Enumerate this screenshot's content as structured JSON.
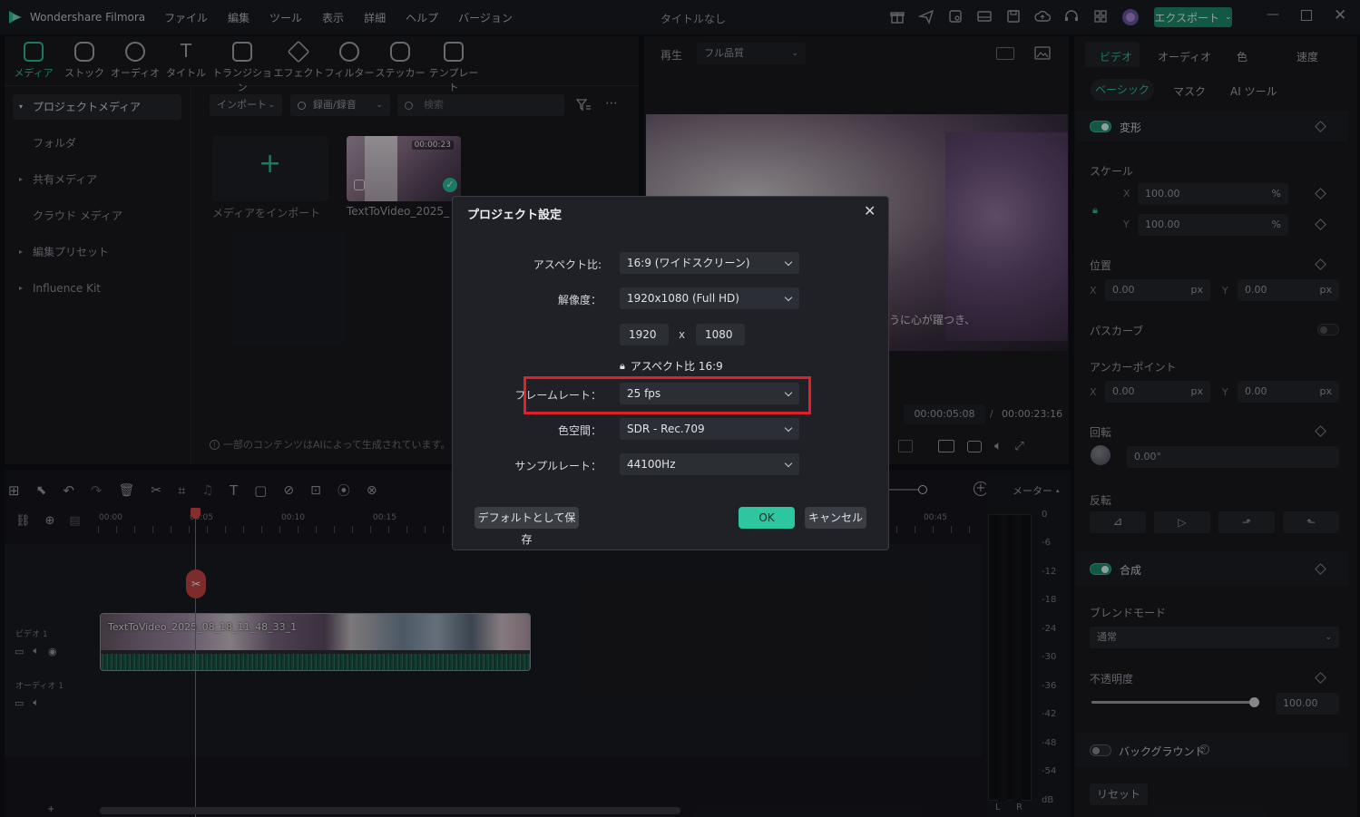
{
  "app": {
    "name": "Wondershare Filmora",
    "menu": [
      "ファイル",
      "編集",
      "ツール",
      "表示",
      "詳細",
      "ヘルプ",
      "バージョン"
    ],
    "project_title": "タイトルなし",
    "export_label": "エクスポート"
  },
  "toolbar": {
    "tabs": [
      "メディア",
      "ストック",
      "オーディオ",
      "タイトル",
      "トランジション",
      "エフェクト",
      "フィルター",
      "ステッカー",
      "テンプレート"
    ]
  },
  "sidebar": {
    "items": [
      "プロジェクトメディア",
      "フォルダ",
      "共有メディア",
      "クラウド メディア",
      "編集プリセット",
      "Influence Kit"
    ]
  },
  "media": {
    "import_label": "インポート",
    "record_label": "録画/録音",
    "search_placeholder": "検索",
    "import_tile_label": "メディアをインポート",
    "clip_name": "TextToVideo_2025_",
    "clip_duration": "00:00:23",
    "ai_notice": "一部のコンテンツはAIによって生成されています。これが"
  },
  "player": {
    "play_label": "再生",
    "quality": "フル品質",
    "current_time": "00:00:05:08",
    "separator": "/",
    "total_time": "00:00:23:16",
    "subtitle_fragment": "うに心が躍つき、"
  },
  "right_panel": {
    "tabs": [
      "ビデオ",
      "オーディオ",
      "色",
      "速度"
    ],
    "subtabs": [
      "ベーシック",
      "マスク",
      "AI ツール"
    ],
    "transform": "変形",
    "scale": "スケール",
    "scale_x": "100.00",
    "scale_y": "100.00",
    "percent": "%",
    "position": "位置",
    "pos_x": "0.00",
    "pos_y": "0.00",
    "px": "px",
    "path_curve": "パスカーブ",
    "anchor": "アンカーポイント",
    "anchor_x": "0.00",
    "anchor_y": "0.00",
    "rotation": "回転",
    "rotation_value": "0.00°",
    "flip": "反転",
    "composite": "合成",
    "blend_mode": "ブレンドモード",
    "blend_value": "通常",
    "opacity": "不透明度",
    "opacity_value": "100.00",
    "opacity_level": 1.0,
    "background": "バックグラウンド",
    "reset": "リセット",
    "axis_x": "X",
    "axis_y": "Y"
  },
  "timeline": {
    "ruler": [
      "00:00",
      "00:05",
      "00:10",
      "00:15",
      "00:45"
    ],
    "video_track": "ビデオ 1",
    "audio_track": "オーディオ 1",
    "clip_title": "TextToVideo_2025_08_18_11_48_33_1",
    "meter_label": "メーター",
    "meter_scale": [
      "0",
      "-6",
      "-12",
      "-18",
      "-24",
      "-30",
      "-36",
      "-42",
      "-48",
      "-54",
      "dB"
    ],
    "meter_l": "L",
    "meter_r": "R"
  },
  "dialog": {
    "title": "プロジェクト設定",
    "aspect_label": "アスペクト比:",
    "aspect_value": "16:9 (ワイドスクリーン)",
    "resolution_label": "解像度：",
    "resolution_value": "1920x1080 (Full HD)",
    "width": "1920",
    "x": "x",
    "height": "1080",
    "aspect_lock": "アスペクト比 16:9",
    "framerate_label": "フレームレート：",
    "framerate_value": "25 fps",
    "colorspace_label": "色空間：",
    "colorspace_value": "SDR - Rec.709",
    "samplerate_label": "サンプルレート：",
    "samplerate_value": "44100Hz",
    "save_default": "デフォルトとして保存",
    "ok": "OK",
    "cancel": "キャンセル"
  },
  "colors": {
    "accent": "#2ec6a0",
    "highlight": "#e0202a",
    "playhead": "#d84b4b"
  }
}
